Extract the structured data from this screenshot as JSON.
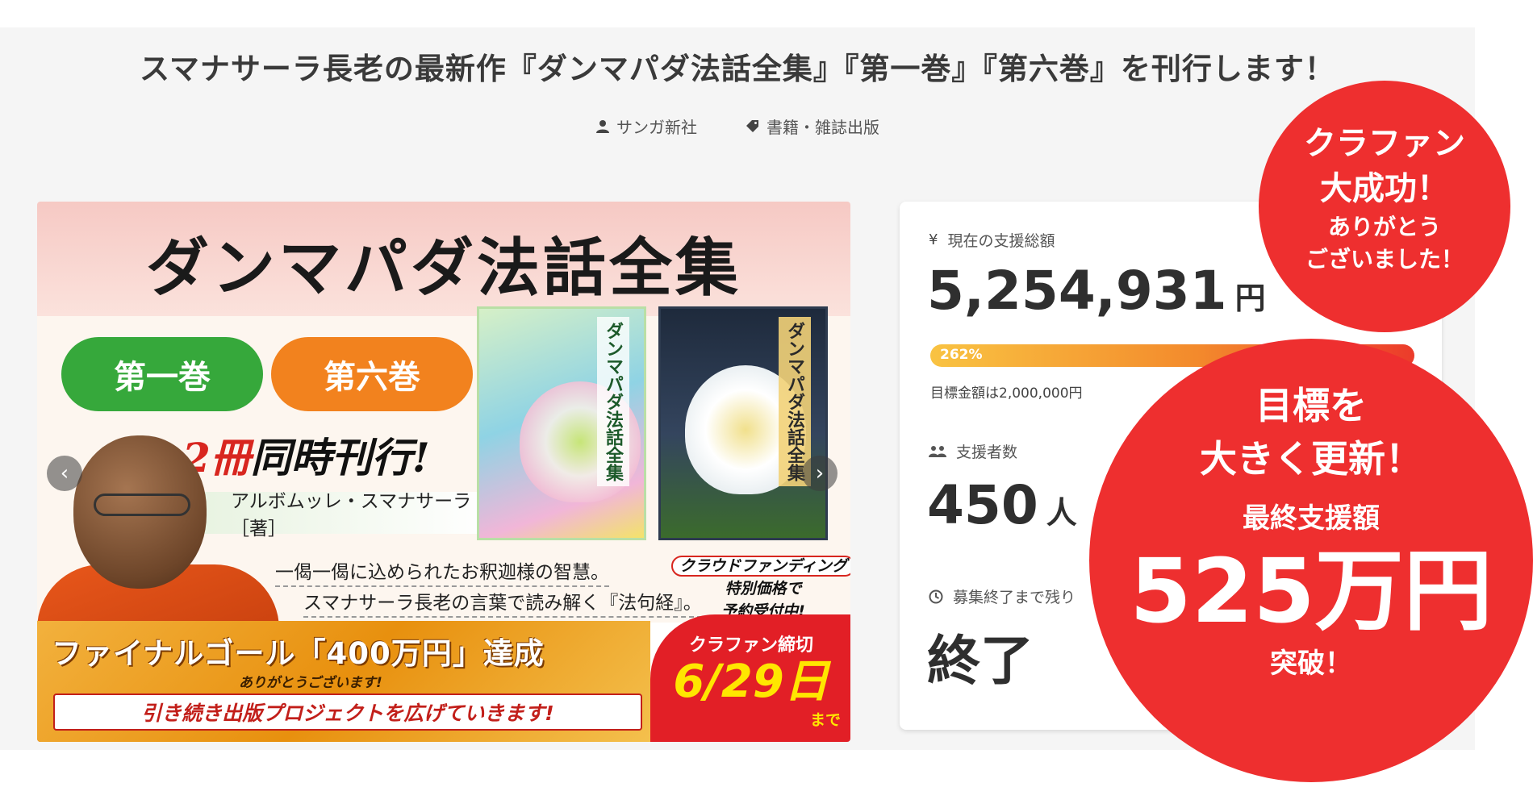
{
  "project": {
    "title": "スマナサーラ長老の最新作『ダンマパダ法話全集』『第一巻』『第六巻』を刊行します！",
    "author_meta": "サンガ新社",
    "category_meta": "書籍・雑誌出版"
  },
  "banner": {
    "title": "ダンマパダ法話全集",
    "volume_1": "第一巻",
    "volume_6": "第六巻",
    "release_prefix": "2冊",
    "release_suffix": "同時刊行!",
    "author_credit": "アルボムッレ・スマナサーラ［著］",
    "book_1_label": "ダンマパダ法話全集",
    "book_2_label": "ダンマパダ法話全集",
    "quote_1": "一偈一偈に込められたお釈迦様の智慧。",
    "quote_2": "スマナサーラ長老の言葉で読み解く『法句経』。",
    "cf_line_1": "クラウドファンディング",
    "cf_line_2": "特別価格で",
    "cf_line_3": "予約受付中!",
    "final_goal": "ファイナルゴール「400万円」達成",
    "thanks": "ありがとうございます!",
    "continue": "引き続き出版プロジェクトを広げていきます!",
    "deadline_label": "クラファン締切",
    "deadline_date": "6/29日",
    "deadline_until": "まで",
    "prev_arrow": "‹",
    "next_arrow": "›"
  },
  "stats": {
    "total_label": "現在の支援総額",
    "total_value": "5,254,931",
    "total_unit": "円",
    "progress_text": "262%",
    "progress_percent": 262,
    "goal_note": "目標金額は2,000,000円",
    "backers_label": "支援者数",
    "backers_value": "450",
    "backers_unit": "人",
    "remaining_label": "募集終了まで残り",
    "remaining_value": "終了"
  },
  "overlay_top": {
    "line_1": "クラファン",
    "line_2": "大成功！",
    "line_3": "ありがとう",
    "line_4": "ございました！"
  },
  "overlay_main": {
    "line_1": "目標を",
    "line_2": "大きく更新！",
    "line_3": "最終支援額",
    "line_4": "525万円",
    "line_5": "突破！"
  },
  "colors": {
    "accent_red": "#ee2f2f",
    "volume_green": "#36a83b",
    "volume_orange": "#f2821e"
  },
  "icons": {
    "author": "user-icon",
    "category": "tag-icon",
    "money": "yen-icon",
    "backers": "people-icon",
    "time": "clock-icon"
  }
}
